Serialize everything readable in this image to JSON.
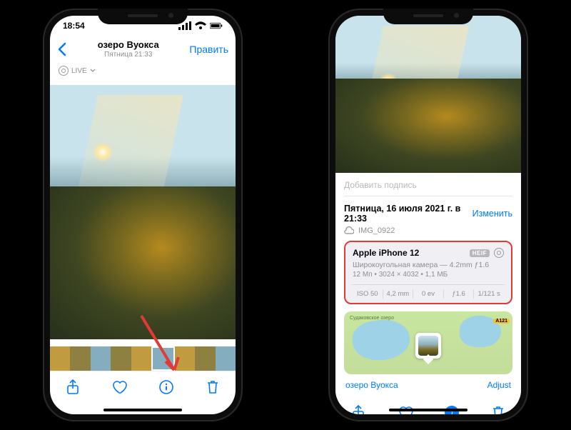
{
  "left": {
    "status": {
      "time": "18:54"
    },
    "nav": {
      "title": "озеро Вуокса",
      "subtitle": "Пятница  21:33",
      "edit": "Править"
    },
    "live_label": "LIVE",
    "toolbar": {
      "share": "share-icon",
      "like": "heart-icon",
      "info": "info-icon",
      "trash": "trash-icon"
    }
  },
  "right": {
    "caption_placeholder": "Добавить подпись",
    "date": "Пятница, 16 июля 2021 г. в 21:33",
    "edit_link": "Изменить",
    "filename": "IMG_0922",
    "device": "Apple iPhone 12",
    "heif_badge": "HEIF",
    "lens": "Широкоугольная камера — 4.2mm ƒ1.6",
    "specs": "12 Мп   •   3024 × 4032   •   1,1 МБ",
    "exif": {
      "iso": "ISO 50",
      "focal": "4,2 mm",
      "ev": "0 ev",
      "aperture": "ƒ1.6",
      "shutter": "1/121 s"
    },
    "map": {
      "label": "Судаковское озеро",
      "road": "А121"
    },
    "place": "озеро Вуокса",
    "adjust": "Adjust"
  }
}
